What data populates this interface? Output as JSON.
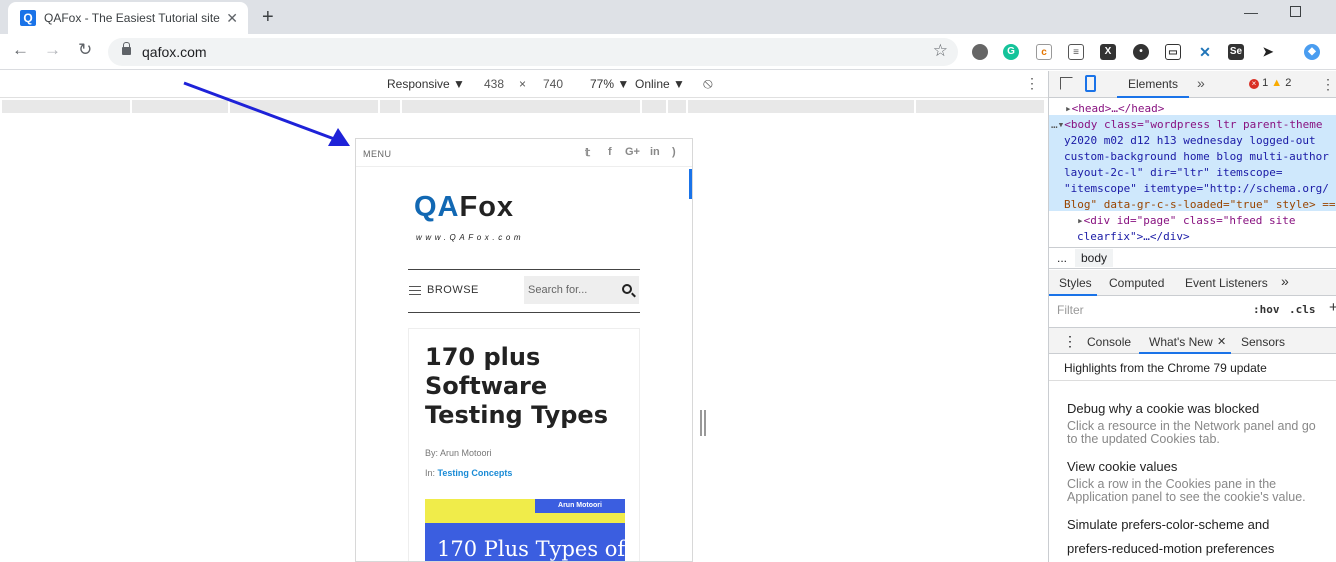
{
  "browser": {
    "tab_title": "QAFox - The Easiest Tutorial site",
    "favicon_letter": "Q",
    "url": "qafox.com",
    "new_tab_glyph": "+",
    "close_glyph": "✕",
    "minimize_glyph": "—"
  },
  "device_toolbar": {
    "mode": "Responsive ▼",
    "width": "438",
    "times": "×",
    "height": "740",
    "zoom": "77% ▼",
    "network": "Online ▼"
  },
  "site": {
    "menu_label": "MENU",
    "logo_qa": "QA",
    "logo_fox": "Fox",
    "logo_sub": "www.QAFox.com",
    "browse_label": "BROWSE",
    "search_placeholder": "Search for...",
    "post_title": "170 plus Software Testing Types",
    "by": "By: Arun Motoori",
    "in_label": "In: ",
    "in_link": "Testing Concepts",
    "thumb_band": "Arun Motoori",
    "thumb_text": "170 Plus Types of"
  },
  "devtools": {
    "tab_elements": "Elements",
    "more": "»",
    "errors": "1",
    "warnings": "2",
    "dom_head": "<head>…</head>",
    "dom_body_lines": [
      "<body class=\"wordpress ltr parent-theme",
      "y2020 m02 d12 h13 wednesday logged-out",
      "custom-background home blog multi-author",
      "layout-2c-l\" dir=\"ltr\" itemscope=",
      "\"itemscope\" itemtype=\"http://schema.org/",
      "Blog\" data-gr-c-s-loaded=\"true\" style> =="
    ],
    "dom_div_1": "<div id=\"page\" class=\"hfeed site",
    "dom_div_2": "clearfix\">…</div>",
    "crumb_dots": "...",
    "crumb": "body",
    "styles_tabs": [
      "Styles",
      "Computed",
      "Event Listeners",
      "»"
    ],
    "filter_placeholder": "Filter",
    "hov": ":hov",
    "cls": ".cls",
    "plus": "+",
    "drawer_tabs": [
      "Console",
      "What's New",
      "Sensors"
    ],
    "drawer_close": "✕",
    "highlights": "Highlights from the Chrome 79 update",
    "items": [
      {
        "title": "Debug why a cookie was blocked",
        "desc": "Click a resource in the Network panel and go to the updated Cookies tab."
      },
      {
        "title": "View cookie values",
        "desc": "Click a row in the Cookies pane in the Application panel to see the cookie's value."
      },
      {
        "title": "Simulate prefers-color-scheme and",
        "desc": ""
      },
      {
        "title": "prefers-reduced-motion preferences",
        "desc": ""
      }
    ]
  },
  "colors": {
    "accent": "#1a73e8",
    "logo_blue": "#1268b3",
    "arrow": "#1e22d8"
  }
}
